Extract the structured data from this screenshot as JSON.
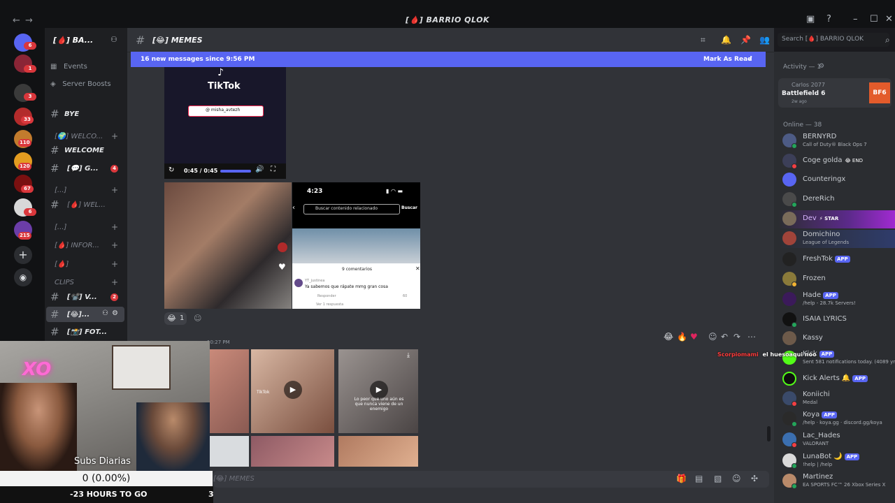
{
  "titlebar": {
    "back": "←",
    "forward": "→",
    "server_title": "[🩸] BARRIO QLOK",
    "inbox_icon": "inbox-icon",
    "help_icon": "help-icon",
    "minimize": "–",
    "maximize": "☐",
    "close": "✕"
  },
  "servers": {
    "badges": [
      "6",
      "1",
      "3",
      "33",
      "110",
      "120",
      "67",
      "6",
      "215"
    ]
  },
  "sidebar": {
    "server_name": "[🩸] BA...",
    "events": "Events",
    "server_boosts": "Server Boosts",
    "channels": [
      {
        "label": "BYE"
      },
      {
        "label": "[🌍] WELCO..."
      },
      {
        "label": "WELCOME"
      },
      {
        "label": "[💬] G...",
        "mention": "4"
      },
      {
        "label": "[...]"
      },
      {
        "label": "[🩸] WEL..."
      },
      {
        "label": "[...]"
      },
      {
        "label": "[🩸] INFOR..."
      },
      {
        "label": "[🩸]"
      },
      {
        "label": "CLIPS"
      },
      {
        "label": "[📽️] V...",
        "mention": "2"
      },
      {
        "label": "[😂]..."
      },
      {
        "label": "[📸] FOT..."
      }
    ]
  },
  "header": {
    "channel_name": "[😂] MEMES",
    "search_placeholder": "Search [🩸] BARRIO QLOK"
  },
  "banner": {
    "text": "16 new messages since 9:56 PM",
    "action": "Mark As Read"
  },
  "messages": {
    "tiktok": {
      "logo": "TikTok",
      "handle": "@ misha_avtezh",
      "time": "0:45 / 0:45"
    },
    "phone": {
      "clock": "4:23",
      "search_placeholder": "Buscar contenido relacionado",
      "search_btn": "Buscar",
      "comments_title": "9 comentarios",
      "comment_user": "YT_justinea",
      "comment_text": "Ya sabemos que rápate mmg gran cosa",
      "reply": "Responder",
      "view_replies": "Ver 1 respuesta",
      "likes": "60"
    },
    "reaction_count": "1",
    "second_timestamp": "10:27 PM",
    "video_caption": "Lo peor que uno aún es que nunca viene de un enemigo",
    "watermark": "TikTok"
  },
  "chat_input": {
    "placeholder": "[😂] MEMES"
  },
  "overlay": {
    "subs_label": "Subs Diarias",
    "subs_value": "0 (0.00%)",
    "hours": "-23 HOURS TO GO",
    "count": "3",
    "chat_user": "Scorpiomami",
    "chat_msg": "el huesoaqui noo"
  },
  "members": {
    "activity_header": "Activity — 1",
    "activity": {
      "user": "Carlos 2077",
      "game": "Battlefield 6",
      "time": "2w ago",
      "badge": "BF6"
    },
    "online_header": "Online — 38",
    "list": [
      {
        "name": "BERNYRD",
        "status": "Call of Duty® Black Ops 7"
      },
      {
        "name": "Coge golda",
        "status": "",
        "tag": "😂 END"
      },
      {
        "name": "Counteringx",
        "status": ""
      },
      {
        "name": "DereRich",
        "status": ""
      },
      {
        "name": "Dev",
        "status": "",
        "tag": "⚡ STAR"
      },
      {
        "name": "Domichino",
        "status": "League of Legends"
      },
      {
        "name": "FreshTok",
        "status": "",
        "app": "APP"
      },
      {
        "name": "Frozen",
        "status": ""
      },
      {
        "name": "Hade",
        "status": "/help - 28.7k Servers!",
        "app": "APP"
      },
      {
        "name": "ISAIA LYRICS",
        "status": ""
      },
      {
        "name": "Kassy",
        "status": ""
      },
      {
        "name": "Kick",
        "status": "Sent 581 notifications today. (4089 yr",
        "app": "APP"
      },
      {
        "name": "Kick Alerts",
        "status": "",
        "app": "APP"
      },
      {
        "name": "Koniichi",
        "status": "Medal"
      },
      {
        "name": "Koya",
        "status": "/help · koya.gg · discord.gg/koya",
        "app": "APP"
      },
      {
        "name": "Lac_Hades",
        "status": "VALORANT"
      },
      {
        "name": "LunaBot",
        "status": "!help | /help",
        "app": "APP"
      },
      {
        "name": "Martinez",
        "status": "EA SPORTS FC™ 26 Xbox Series X"
      }
    ]
  }
}
